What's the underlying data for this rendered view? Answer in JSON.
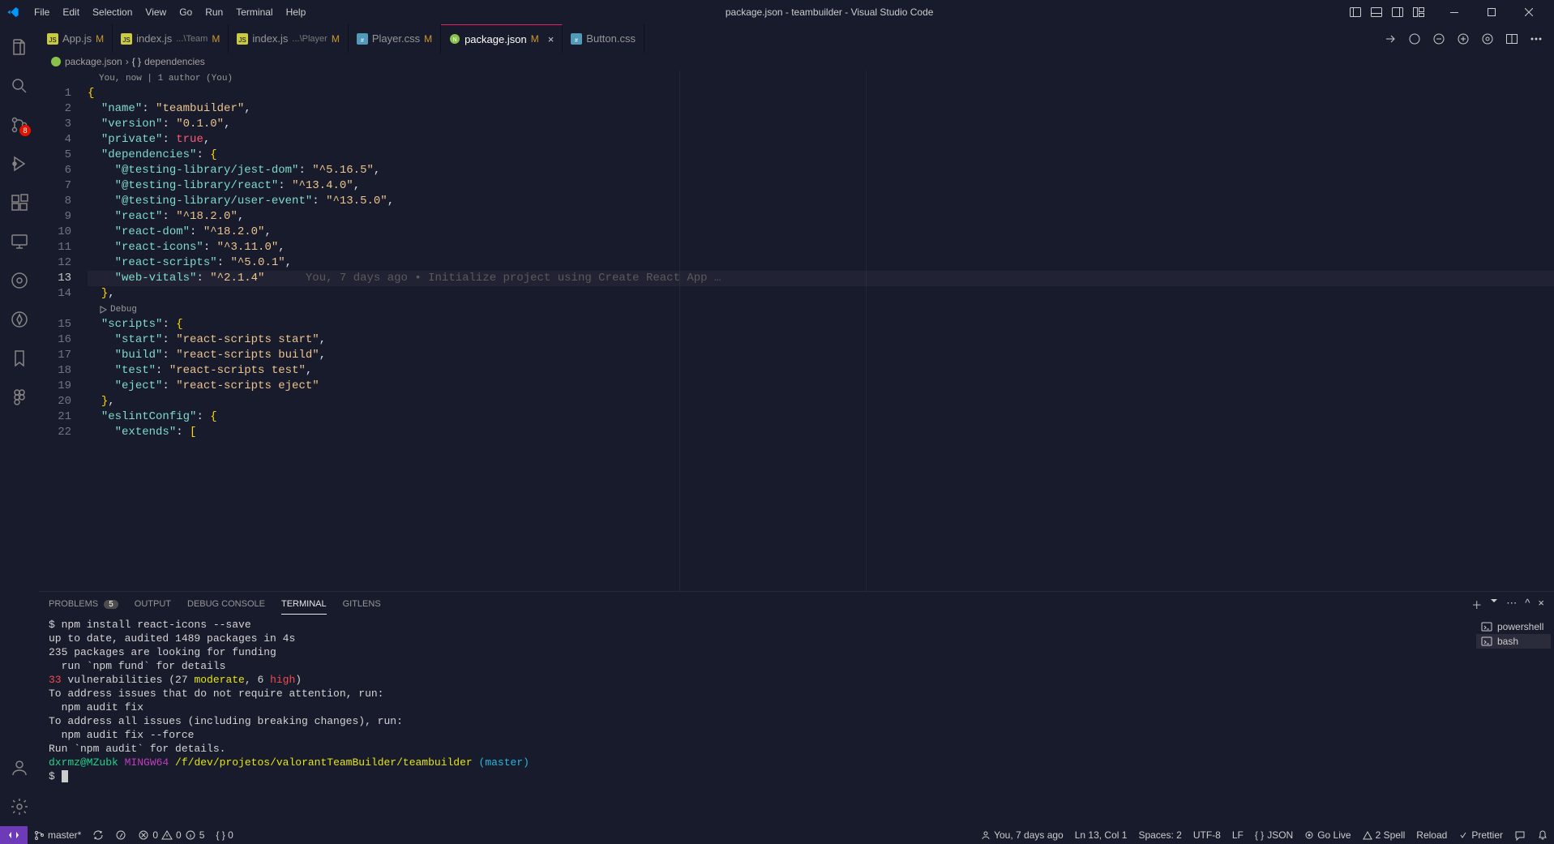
{
  "titlebar": {
    "title": "package.json - teambuilder - Visual Studio Code",
    "menus": [
      "File",
      "Edit",
      "Selection",
      "View",
      "Go",
      "Run",
      "Terminal",
      "Help"
    ]
  },
  "activitybar": {
    "explorer": "Explorer",
    "search": "Search",
    "scm_badge": "8",
    "run": "Run and Debug",
    "extensions": "Extensions"
  },
  "tabs": [
    {
      "icon": "js",
      "name": "App.js",
      "dim": "",
      "mod": "M",
      "active": false,
      "color": "#cbcb41"
    },
    {
      "icon": "js",
      "name": "index.js",
      "dim": "...\\Team",
      "mod": "M",
      "active": false,
      "color": "#cbcb41"
    },
    {
      "icon": "js",
      "name": "index.js",
      "dim": "...\\Player",
      "mod": "M",
      "active": false,
      "color": "#cbcb41"
    },
    {
      "icon": "css",
      "name": "Player.css",
      "dim": "",
      "mod": "M",
      "active": false,
      "color": "#519aba"
    },
    {
      "icon": "json",
      "name": "package.json",
      "dim": "",
      "mod": "M",
      "active": true,
      "color": "#cbcb41"
    },
    {
      "icon": "css",
      "name": "Button.css",
      "dim": "",
      "mod": "",
      "active": false,
      "color": "#519aba"
    }
  ],
  "breadcrumb": {
    "file": "package.json",
    "symbol": "dependencies"
  },
  "editor": {
    "codelens_author": "You, now | 1 author (You)",
    "debug_codelens": "Debug",
    "blame_line13": "You, 7 days ago • Initialize project using Create React App …",
    "lines": [
      {
        "n": 1,
        "html": "<span class='tok-brace'>{</span>"
      },
      {
        "n": 2,
        "html": "  <span class='tok-key'>\"name\"</span><span class='tok-punc'>:</span> <span class='tok-strv'>\"teambuilder\"</span><span class='tok-punc'>,</span>"
      },
      {
        "n": 3,
        "html": "  <span class='tok-key'>\"version\"</span><span class='tok-punc'>:</span> <span class='tok-strv'>\"0.1.0\"</span><span class='tok-punc'>,</span>"
      },
      {
        "n": 4,
        "html": "  <span class='tok-key'>\"private\"</span><span class='tok-punc'>:</span> <span class='tok-bool'>true</span><span class='tok-punc'>,</span>"
      },
      {
        "n": 5,
        "html": "  <span class='tok-key'>\"dependencies\"</span><span class='tok-punc'>:</span> <span class='tok-brace'>{</span>"
      },
      {
        "n": 6,
        "html": "    <span class='tok-key'>\"@testing-library/jest-dom\"</span><span class='tok-punc'>:</span> <span class='tok-strv'>\"^5.16.5\"</span><span class='tok-punc'>,</span>"
      },
      {
        "n": 7,
        "html": "    <span class='tok-key'>\"@testing-library/react\"</span><span class='tok-punc'>:</span> <span class='tok-strv'>\"^13.4.0\"</span><span class='tok-punc'>,</span>"
      },
      {
        "n": 8,
        "html": "    <span class='tok-key'>\"@testing-library/user-event\"</span><span class='tok-punc'>:</span> <span class='tok-strv'>\"^13.5.0\"</span><span class='tok-punc'>,</span>"
      },
      {
        "n": 9,
        "html": "    <span class='tok-key'>\"react\"</span><span class='tok-punc'>:</span> <span class='tok-strv'>\"^18.2.0\"</span><span class='tok-punc'>,</span>"
      },
      {
        "n": 10,
        "html": "    <span class='tok-key'>\"react-dom\"</span><span class='tok-punc'>:</span> <span class='tok-strv'>\"^18.2.0\"</span><span class='tok-punc'>,</span>"
      },
      {
        "n": 11,
        "html": "    <span class='tok-key'>\"react-icons\"</span><span class='tok-punc'>:</span> <span class='tok-strv'>\"^3.11.0\"</span><span class='tok-punc'>,</span>"
      },
      {
        "n": 12,
        "html": "    <span class='tok-key'>\"react-scripts\"</span><span class='tok-punc'>:</span> <span class='tok-strv'>\"^5.0.1\"</span><span class='tok-punc'>,</span>"
      },
      {
        "n": 13,
        "html": "    <span class='tok-key'>\"web-vitals\"</span><span class='tok-punc'>:</span> <span class='tok-strv'>\"^2.1.4\"</span>",
        "current": true
      },
      {
        "n": 14,
        "html": "  <span class='tok-brace'>}</span><span class='tok-punc'>,</span>"
      },
      {
        "n": 15,
        "html": "  <span class='tok-key'>\"scripts\"</span><span class='tok-punc'>:</span> <span class='tok-brace'>{</span>"
      },
      {
        "n": 16,
        "html": "    <span class='tok-key'>\"start\"</span><span class='tok-punc'>:</span> <span class='tok-strv'>\"react-scripts start\"</span><span class='tok-punc'>,</span>"
      },
      {
        "n": 17,
        "html": "    <span class='tok-key'>\"build\"</span><span class='tok-punc'>:</span> <span class='tok-strv'>\"react-scripts build\"</span><span class='tok-punc'>,</span>"
      },
      {
        "n": 18,
        "html": "    <span class='tok-key'>\"test\"</span><span class='tok-punc'>:</span> <span class='tok-strv'>\"react-scripts test\"</span><span class='tok-punc'>,</span>"
      },
      {
        "n": 19,
        "html": "    <span class='tok-key'>\"eject\"</span><span class='tok-punc'>:</span> <span class='tok-strv'>\"react-scripts eject\"</span>"
      },
      {
        "n": 20,
        "html": "  <span class='tok-brace'>}</span><span class='tok-punc'>,</span>"
      },
      {
        "n": 21,
        "html": "  <span class='tok-key'>\"eslintConfig\"</span><span class='tok-punc'>:</span> <span class='tok-brace'>{</span>"
      },
      {
        "n": 22,
        "html": "    <span class='tok-key'>\"extends\"</span><span class='tok-punc'>:</span> <span class='tok-brace'>[</span>"
      }
    ]
  },
  "panel": {
    "tabs": {
      "problems": "PROBLEMS",
      "problems_count": "5",
      "output": "OUTPUT",
      "debug_console": "DEBUG CONSOLE",
      "terminal": "TERMINAL",
      "gitlens": "GITLENS"
    },
    "terminals": [
      {
        "name": "powershell",
        "active": false
      },
      {
        "name": "bash",
        "active": true
      }
    ],
    "terminal_output": {
      "l1": "$ npm install react-icons --save",
      "l2": "",
      "l3": "up to date, audited 1489 packages in 4s",
      "l4": "",
      "l5": "235 packages are looking for funding",
      "l6": "  run `npm fund` for details",
      "l7": "",
      "l8_pre": " vulnerabilities (27 ",
      "l8_33": "33",
      "l8_mod": "moderate",
      "l8_mid": ", 6 ",
      "l8_high": "high",
      "l8_end": ")",
      "l9": "",
      "l10": "To address issues that do not require attention, run:",
      "l11": "  npm audit fix",
      "l12": "",
      "l13": "To address all issues (including breaking changes), run:",
      "l14": "  npm audit fix --force",
      "l15": "",
      "l16": "Run `npm audit` for details.",
      "l17": "",
      "prompt_user": "dxrmz@MZubk",
      "prompt_mingw": " MINGW64 ",
      "prompt_path": "/f/dev/projetos/valorantTeamBuilder/teambuilder",
      "prompt_branch": " (master)",
      "prompt_dollar": "$ "
    }
  },
  "statusbar": {
    "branch": "master*",
    "sync": "",
    "errors": "0",
    "warnings": "0",
    "info": "5",
    "bracket": "{ } 0",
    "blame": "You, 7 days ago",
    "cursor": "Ln 13, Col 1",
    "spaces": "Spaces: 2",
    "encoding": "UTF-8",
    "eol": "LF",
    "lang_json": "JSON",
    "golive": "Go Live",
    "spell": "2 Spell",
    "reload": "Reload",
    "prettier": "Prettier",
    "bell": ""
  }
}
